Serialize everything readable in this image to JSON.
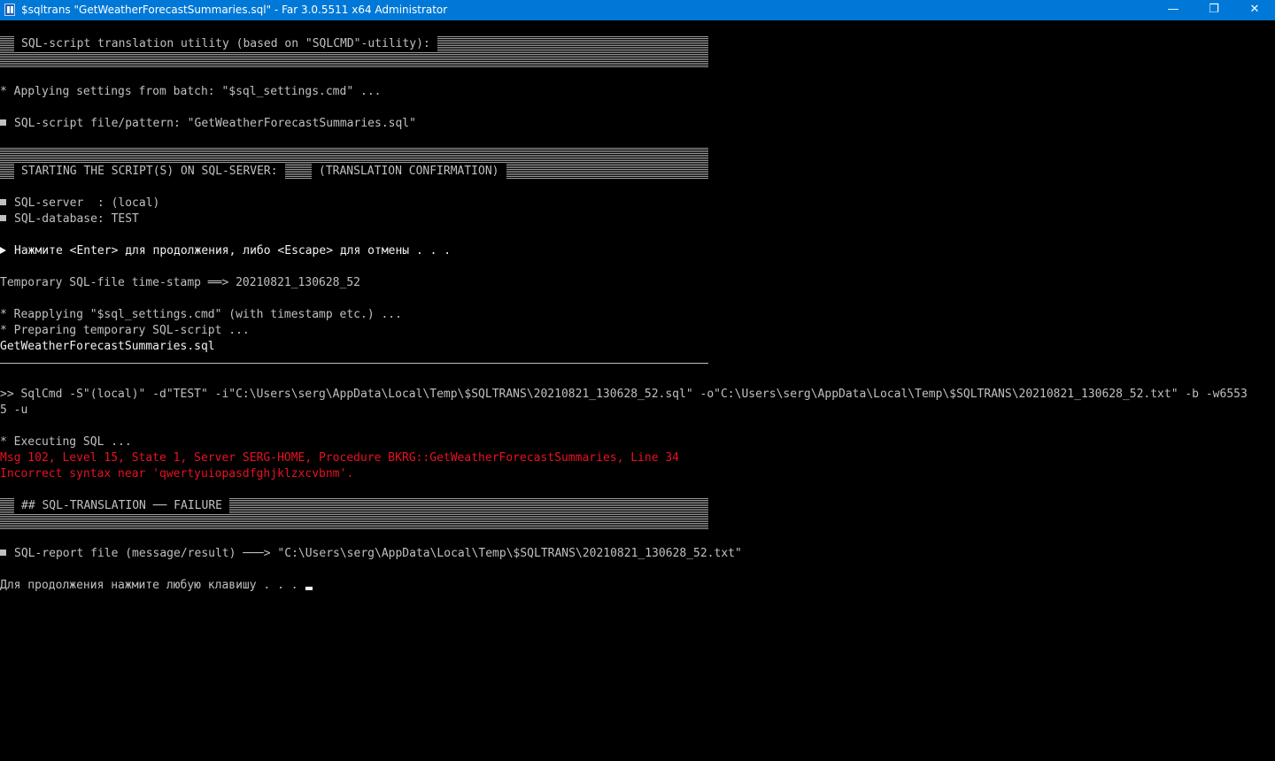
{
  "window": {
    "title": "$sqltrans \"GetWeatherForecastSummaries.sql\" - Far 3.0.5511 x64 Administrator",
    "minimize_glyph": "—",
    "maximize_glyph": "❐",
    "close_glyph": "✕",
    "accent_color": "#0078d7"
  },
  "console": {
    "header_banner": "SQL-script translation utility (based on \"SQLCMD\"-utility):",
    "applying_settings": "* Applying settings from batch: \"$sql_settings.cmd\" ...",
    "script_pattern": "SQL-script file/pattern: \"GetWeatherForecastSummaries.sql\"",
    "start_banner": "STARTING THE SCRIPT(S) ON SQL-SERVER:",
    "start_banner_note": "(TRANSLATION CONFIRMATION)",
    "server_line": "SQL-server  : (local)",
    "database_line": "SQL-database: TEST",
    "confirm_prompt": "Нажмите <Enter> для продолжения, либо <Escape> для отмены . . .",
    "timestamp_line": "Temporary SQL-file time-stamp ══> 20210821_130628_52",
    "reapplying": "* Reapplying \"$sql_settings.cmd\" (with timestamp etc.) ...",
    "preparing": "* Preparing temporary SQL-script ...",
    "script_name": "GetWeatherForecastSummaries.sql",
    "command_line_1": ">> SqlCmd -S\"(local)\" -d\"TEST\" -i\"C:\\Users\\serg\\AppData\\Local\\Temp\\$SQLTRANS\\20210821_130628_52.sql\" -o\"C:\\Users\\serg\\AppData\\Local\\Temp\\$SQLTRANS\\20210821_130628_52.txt\" -b -w6553",
    "command_line_2": "5 -u",
    "executing": "* Executing SQL ...",
    "error_line_1": "Msg 102, Level 15, State 1, Server SERG-HOME, Procedure BKRG::GetWeatherForecastSummaries, Line 34",
    "error_line_2": "Incorrect syntax near 'qwertyuiopasdfghjklzxcvbnm'.",
    "failure_banner": "## SQL-TRANSLATION ── FAILURE",
    "report_line": "SQL-report file (message/result) ───> \"C:\\Users\\serg\\AppData\\Local\\Temp\\$SQLTRANS\\20210821_130628_52.txt\"",
    "press_any_key": "Для продолжения нажмите любую клавишу . . .",
    "text_color": "#c0c0c0",
    "error_color": "#e81123"
  }
}
